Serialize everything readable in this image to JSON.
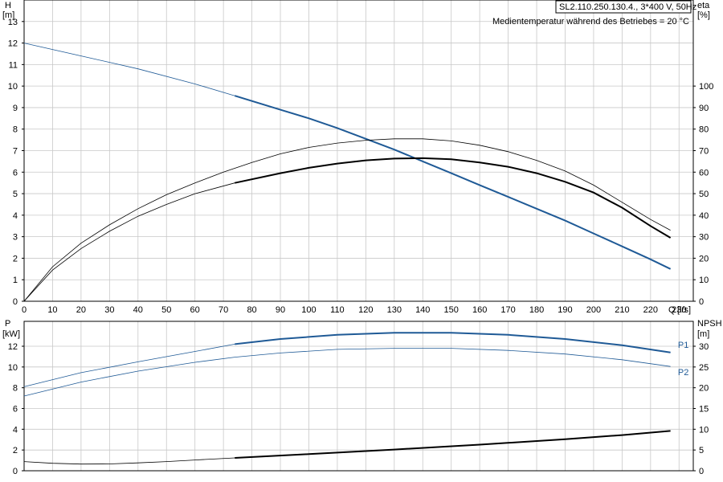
{
  "info": {
    "pump_label": "SL2.110.250.130.4., 3*400 V, 50Hz",
    "medium_note": "Medientemperatur während des Betriebes = 20 °C"
  },
  "colors": {
    "blue": "#1f5a96",
    "black": "#000000",
    "grid": "#c8c8c8"
  },
  "chart_data": [
    {
      "type": "line",
      "panel": "top",
      "x_axis": {
        "label": "Q",
        "unit": "[l/s]",
        "range": [
          0,
          235
        ],
        "ticks": [
          0,
          10,
          20,
          30,
          40,
          50,
          60,
          70,
          80,
          90,
          100,
          110,
          120,
          130,
          140,
          150,
          160,
          170,
          180,
          190,
          200,
          210,
          220,
          230
        ]
      },
      "y_left": {
        "label": "H",
        "unit": "[m]",
        "range": [
          0,
          14
        ],
        "ticks": [
          0,
          1,
          2,
          3,
          4,
          5,
          6,
          7,
          8,
          9,
          10,
          11,
          12,
          13
        ]
      },
      "y_right": {
        "label": "eta",
        "unit": "[%]",
        "range": [
          0,
          140
        ],
        "ticks": [
          0,
          10,
          20,
          30,
          40,
          50,
          60,
          70,
          80,
          90,
          100
        ]
      },
      "grid": true,
      "series": [
        {
          "key": "H",
          "axis": "left",
          "color": "#1f5a96",
          "thick_from": 74,
          "points": [
            [
              0,
              12.0
            ],
            [
              20,
              11.4
            ],
            [
              40,
              10.8
            ],
            [
              60,
              10.1
            ],
            [
              74,
              9.55
            ],
            [
              90,
              8.9
            ],
            [
              100,
              8.5
            ],
            [
              110,
              8.05
            ],
            [
              120,
              7.55
            ],
            [
              130,
              7.05
            ],
            [
              140,
              6.5
            ],
            [
              150,
              5.95
            ],
            [
              160,
              5.4
            ],
            [
              170,
              4.85
            ],
            [
              180,
              4.3
            ],
            [
              190,
              3.75
            ],
            [
              200,
              3.15
            ],
            [
              210,
              2.55
            ],
            [
              220,
              1.95
            ],
            [
              227,
              1.5
            ]
          ]
        },
        {
          "key": "eta_a",
          "axis": "right",
          "color": "#000000",
          "thick_from": 999,
          "points": [
            [
              0,
              0
            ],
            [
              10,
              16
            ],
            [
              20,
              27
            ],
            [
              30,
              35.5
            ],
            [
              40,
              43
            ],
            [
              50,
              49.5
            ],
            [
              60,
              55
            ],
            [
              70,
              60
            ],
            [
              80,
              64.5
            ],
            [
              90,
              68.5
            ],
            [
              100,
              71.5
            ],
            [
              110,
              73.5
            ],
            [
              120,
              74.8
            ],
            [
              130,
              75.5
            ],
            [
              140,
              75.5
            ],
            [
              150,
              74.5
            ],
            [
              160,
              72.5
            ],
            [
              170,
              69.5
            ],
            [
              180,
              65.5
            ],
            [
              190,
              60.5
            ],
            [
              200,
              54
            ],
            [
              210,
              46
            ],
            [
              220,
              38
            ],
            [
              227,
              33
            ]
          ]
        },
        {
          "key": "eta_b",
          "axis": "right",
          "color": "#000000",
          "thick_from": 74,
          "points": [
            [
              0,
              0
            ],
            [
              10,
              14.5
            ],
            [
              20,
              24.5
            ],
            [
              30,
              32.5
            ],
            [
              40,
              39.5
            ],
            [
              50,
              45
            ],
            [
              60,
              50
            ],
            [
              74,
              55
            ],
            [
              90,
              59.5
            ],
            [
              100,
              62
            ],
            [
              110,
              64
            ],
            [
              120,
              65.5
            ],
            [
              130,
              66.3
            ],
            [
              140,
              66.5
            ],
            [
              150,
              66
            ],
            [
              160,
              64.5
            ],
            [
              170,
              62.5
            ],
            [
              180,
              59.5
            ],
            [
              190,
              55.5
            ],
            [
              200,
              50.5
            ],
            [
              210,
              43.5
            ],
            [
              220,
              35
            ],
            [
              227,
              29.5
            ]
          ]
        }
      ]
    },
    {
      "type": "line",
      "panel": "bottom",
      "x_axis": {
        "range": [
          0,
          235
        ]
      },
      "y_left": {
        "label": "P",
        "unit": "[kW]",
        "range": [
          0,
          14.4
        ],
        "ticks": [
          0,
          2,
          4,
          6,
          8,
          10,
          12
        ]
      },
      "y_right": {
        "label": "NPSH",
        "unit": "[m]",
        "range": [
          0,
          36
        ],
        "ticks": [
          0,
          5,
          10,
          15,
          20,
          25,
          30
        ]
      },
      "grid": true,
      "series": [
        {
          "key": "P1",
          "name": "P1",
          "axis": "left",
          "color": "#1f5a96",
          "thick_from": 74,
          "points": [
            [
              0,
              8.1
            ],
            [
              20,
              9.45
            ],
            [
              40,
              10.5
            ],
            [
              60,
              11.5
            ],
            [
              74,
              12.2
            ],
            [
              90,
              12.7
            ],
            [
              110,
              13.1
            ],
            [
              130,
              13.3
            ],
            [
              150,
              13.3
            ],
            [
              170,
              13.1
            ],
            [
              190,
              12.7
            ],
            [
              210,
              12.1
            ],
            [
              227,
              11.4
            ]
          ]
        },
        {
          "key": "P2",
          "name": "P2",
          "axis": "left",
          "color": "#1f5a96",
          "thick_from": 999,
          "points": [
            [
              0,
              7.2
            ],
            [
              20,
              8.55
            ],
            [
              40,
              9.6
            ],
            [
              60,
              10.45
            ],
            [
              74,
              10.95
            ],
            [
              90,
              11.35
            ],
            [
              110,
              11.7
            ],
            [
              130,
              11.8
            ],
            [
              150,
              11.8
            ],
            [
              170,
              11.6
            ],
            [
              190,
              11.25
            ],
            [
              210,
              10.7
            ],
            [
              227,
              10.05
            ]
          ]
        },
        {
          "key": "NPSH",
          "axis": "right",
          "color": "#000000",
          "thick_from": 74,
          "points": [
            [
              0,
              2.2
            ],
            [
              10,
              1.8
            ],
            [
              20,
              1.6
            ],
            [
              30,
              1.65
            ],
            [
              40,
              1.9
            ],
            [
              50,
              2.2
            ],
            [
              60,
              2.6
            ],
            [
              74,
              3.1
            ],
            [
              100,
              4.0
            ],
            [
              130,
              5.1
            ],
            [
              160,
              6.3
            ],
            [
              190,
              7.6
            ],
            [
              210,
              8.6
            ],
            [
              227,
              9.6
            ]
          ]
        }
      ]
    }
  ]
}
